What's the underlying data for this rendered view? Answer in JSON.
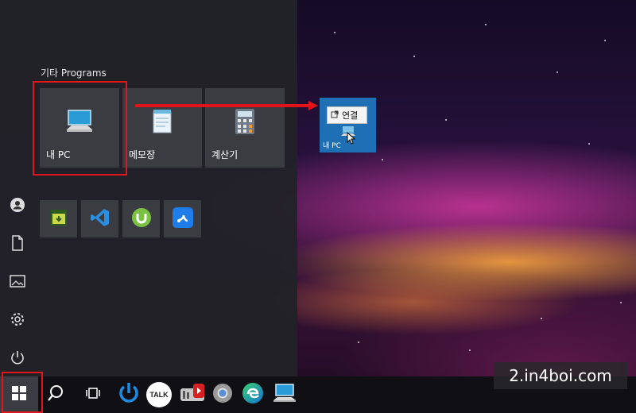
{
  "start_menu": {
    "group_title": "기타 Programs",
    "tiles": [
      {
        "label": "내 PC",
        "icon": "computer-icon"
      },
      {
        "label": "메모장",
        "icon": "notepad-icon"
      },
      {
        "label": "계산기",
        "icon": "calculator-icon"
      }
    ],
    "small_tiles": [
      {
        "icon": "tpe-app-icon"
      },
      {
        "icon": "vscode-icon"
      },
      {
        "icon": "utorrent-icon"
      },
      {
        "icon": "share-app-icon"
      }
    ],
    "rail_icons": [
      "user-icon",
      "documents-icon",
      "pictures-icon",
      "settings-icon",
      "power-icon"
    ]
  },
  "dragged_tile": {
    "label": "내 PC",
    "context_label": "연결"
  },
  "taskbar": {
    "items": [
      "windows-start-icon",
      "search-icon",
      "task-view-icon",
      "power-app-icon",
      "kakaotalk-icon",
      "youtube-downloader-icon",
      "chrome-icon",
      "edge-icon",
      "this-pc-icon"
    ],
    "kakao_text": "TALK"
  },
  "watermark": "2.in4boi.com",
  "colors": {
    "highlight": "#e0181b",
    "tile_bg": "#3b3b42",
    "menu_bg": "#222228",
    "drag_tile_bg": "#1e6fb3"
  }
}
